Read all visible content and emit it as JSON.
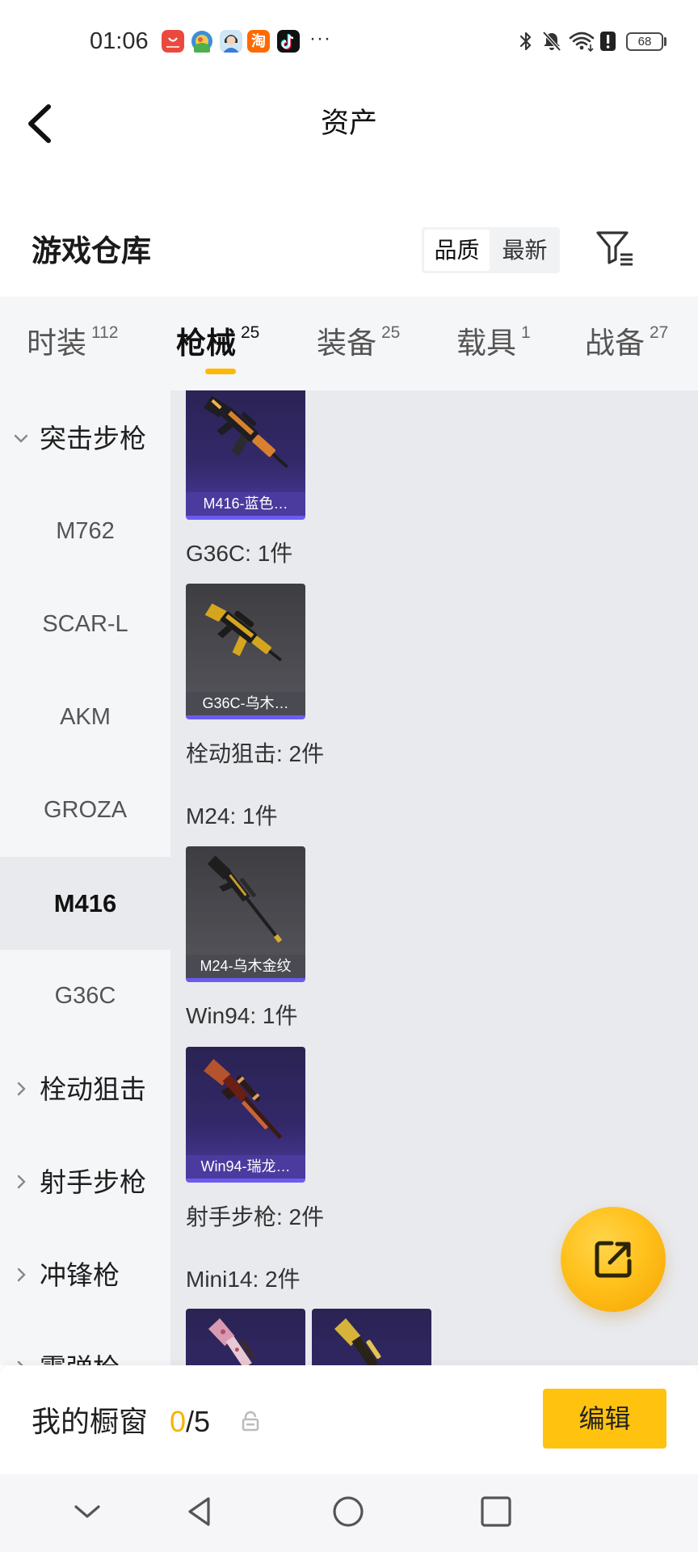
{
  "status_bar": {
    "time": "01:06",
    "notification_icons": [
      "huawei-store-icon",
      "game-app-icon",
      "avatar-app-icon",
      "taobao-app-icon",
      "tiktok-app-icon"
    ],
    "taobao_glyph": "淘",
    "overflow": "···",
    "system_icons": [
      "bluetooth-icon",
      "mute-icon",
      "wifi-icon",
      "alert-icon",
      "battery-icon"
    ],
    "battery": "68"
  },
  "header": {
    "title": "资产",
    "back_icon": "chevron-left-icon"
  },
  "warehouse": {
    "title": "游戏仓库",
    "sort": [
      {
        "label": "品质",
        "selected": true
      },
      {
        "label": "最新",
        "selected": false
      }
    ],
    "filter_icon": "filter-icon"
  },
  "tabs": [
    {
      "label": "时装",
      "count": "112",
      "active": false
    },
    {
      "label": "枪械",
      "count": "25",
      "active": true
    },
    {
      "label": "装备",
      "count": "25",
      "active": false
    },
    {
      "label": "载具",
      "count": "1",
      "active": false
    },
    {
      "label": "战备",
      "count": "27",
      "active": false
    }
  ],
  "sidebar": {
    "items": [
      {
        "label": "突击步枪",
        "kind": "category",
        "expanded": true,
        "icon": "chevron-down-icon"
      },
      {
        "label": "M762",
        "kind": "weapon"
      },
      {
        "label": "SCAR-L",
        "kind": "weapon"
      },
      {
        "label": "AKM",
        "kind": "weapon"
      },
      {
        "label": "GROZA",
        "kind": "weapon"
      },
      {
        "label": "M416",
        "kind": "weapon",
        "selected": true
      },
      {
        "label": "G36C",
        "kind": "weapon"
      },
      {
        "label": "栓动狙击",
        "kind": "category",
        "expanded": false,
        "icon": "chevron-right-icon"
      },
      {
        "label": "射手步枪",
        "kind": "category",
        "expanded": false,
        "icon": "chevron-right-icon"
      },
      {
        "label": "冲锋枪",
        "kind": "category",
        "expanded": false,
        "icon": "chevron-right-icon"
      },
      {
        "label": "霰弹枪",
        "kind": "category",
        "expanded": false,
        "icon": "chevron-right-icon"
      }
    ]
  },
  "content": {
    "blocks": [
      {
        "type": "card",
        "label": "M416-蓝色…",
        "frame": "purple"
      },
      {
        "type": "heading",
        "text": "G36C: 1件"
      },
      {
        "type": "card",
        "label": "G36C-乌木…",
        "frame": "gray"
      },
      {
        "type": "heading",
        "text": "栓动狙击: 2件"
      },
      {
        "type": "heading",
        "text": "M24: 1件"
      },
      {
        "type": "card",
        "label": "M24-乌木金纹",
        "frame": "gray"
      },
      {
        "type": "heading",
        "text": "Win94: 1件"
      },
      {
        "type": "card",
        "label": "Win94-瑞龙…",
        "frame": "purple"
      },
      {
        "type": "heading",
        "text": "射手步枪: 2件"
      },
      {
        "type": "heading",
        "text": "Mini14: 2件"
      },
      {
        "type": "card_row",
        "cards": [
          {
            "frame": "purple"
          },
          {
            "frame": "purple"
          }
        ]
      }
    ]
  },
  "fab": {
    "icon": "share-external-icon"
  },
  "showcase": {
    "title": "我的橱窗",
    "count": "0",
    "limit": "/5",
    "lock_icon": "lock-icon",
    "edit_label": "编辑"
  },
  "nav_bar": {
    "icons": [
      "collapse-chevron-icon",
      "back-icon",
      "home-icon",
      "recents-icon"
    ]
  },
  "colors": {
    "accent": "#FFC20E",
    "accent_text": "#F5B400",
    "tab_indicator": "#FFB800",
    "card_frame": "#6A5CF0",
    "content_bg": "#E9EAEE",
    "sidebar_bg": "#F5F6F8"
  }
}
